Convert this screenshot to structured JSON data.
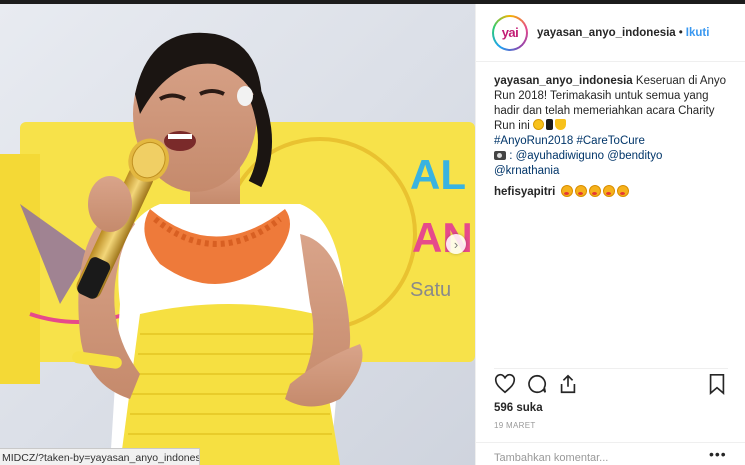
{
  "post": {
    "username": "yayasan_anyo_indonesia",
    "follow_label": "Ikuti",
    "avatar_text": "yai",
    "caption_user": "yayasan_anyo_indonesia",
    "caption_text": "Keseruan di Anyo Run 2018! Terimakasih untuk semua yang hadir dan telah memeriahkan acara Charity Run ini",
    "hashtags": "#AnyoRun2018 #CareToCure",
    "credits": ": @ayuhadiwiguno @bendityo",
    "credits2": "@krnathania",
    "comment_user": "hefisyapitri",
    "likes": "596 suka",
    "date": "19 MARET",
    "add_comment_placeholder": "Tambahkan komentar...",
    "more_label": "•••"
  },
  "photo": {
    "banner_text_1": "AL",
    "banner_text_2": "AN",
    "banner_text_3": "Satu",
    "status_url": "MIDCZ/?taken-by=yayasan_anyo_indonesia"
  },
  "icons": {
    "like": "heart-icon",
    "comment": "comment-icon",
    "share": "share-icon",
    "save": "bookmark-icon",
    "next": "chevron-right-icon",
    "camera": "camera-icon"
  },
  "colors": {
    "link": "#003569",
    "follow": "#3897f0",
    "banner_yellow": "#f7e24a",
    "dress_yellow": "#f6e041",
    "necklace_orange": "#ee7a3a"
  }
}
